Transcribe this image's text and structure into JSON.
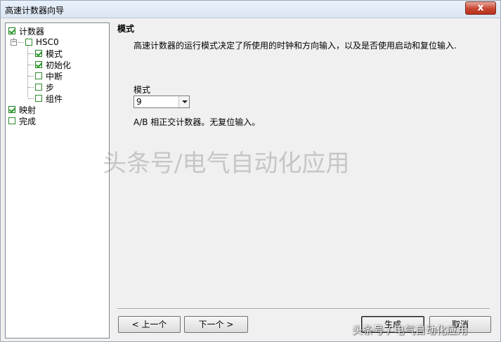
{
  "window": {
    "title": "高速计数器向导",
    "close_label": "x"
  },
  "tree": {
    "items": [
      {
        "label": "计数器",
        "checked": true
      },
      {
        "label": "HSC0",
        "checked": false
      },
      {
        "label": "模式",
        "checked": true
      },
      {
        "label": "初始化",
        "checked": true
      },
      {
        "label": "中断",
        "checked": false
      },
      {
        "label": "步",
        "checked": false
      },
      {
        "label": "组件",
        "checked": false
      },
      {
        "label": "映射",
        "checked": true
      },
      {
        "label": "完成",
        "checked": false
      }
    ],
    "expander_symbol": "−"
  },
  "main": {
    "section_title": "模式",
    "description": "高速计数器的运行模式决定了所使用的时钟和方向输入，以及是否使用启动和复位输入.",
    "mode_label": "模式",
    "mode_value": "9",
    "mode_description": "A/B 相正交计数器。无复位输入。"
  },
  "buttons": {
    "prev": "< 上一个",
    "next": "下一个 >",
    "generate": "生成",
    "cancel": "取消"
  },
  "watermarks": {
    "center": "头条号/电气自动化应用",
    "corner": "头条号 / 电气自动化应用"
  }
}
